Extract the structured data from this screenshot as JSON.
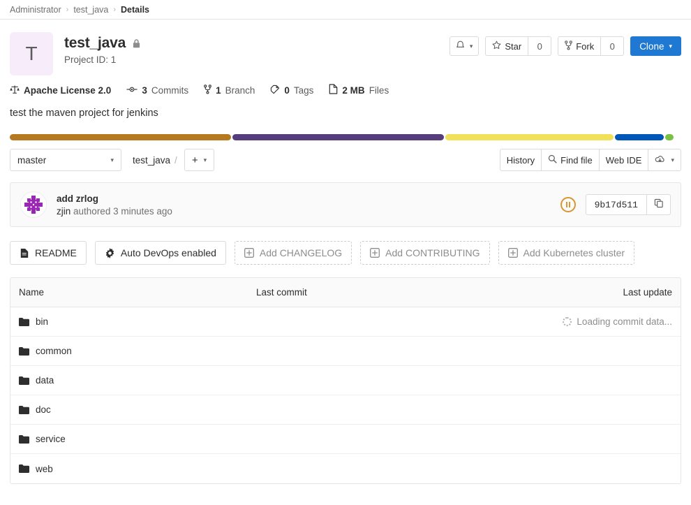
{
  "breadcrumb": {
    "items": [
      "Administrator",
      "test_java"
    ],
    "current": "Details",
    "separator": "›"
  },
  "project": {
    "avatar_letter": "T",
    "avatar_bg": "#f7ecfa",
    "name": "test_java",
    "visibility_icon": "lock-icon",
    "project_id_label": "Project ID: 1",
    "description": "test the maven project for jenkins"
  },
  "header_actions": {
    "notification_icon": "bell-icon",
    "star_label": "Star",
    "star_count": "0",
    "fork_label": "Fork",
    "fork_count": "0",
    "clone_label": "Clone",
    "clone_color": "#1f78d1"
  },
  "stats": [
    {
      "icon": "scale-icon",
      "value": "Apache License 2.0",
      "label": ""
    },
    {
      "icon": "commit-icon",
      "value": "3",
      "label": "Commits"
    },
    {
      "icon": "branch-icon",
      "value": "1",
      "label": "Branch"
    },
    {
      "icon": "tag-icon",
      "value": "0",
      "label": "Tags"
    },
    {
      "icon": "file-icon",
      "value": "2 MB",
      "label": "Files"
    }
  ],
  "language_bar": [
    {
      "color": "#b7791f",
      "percent": 33.0
    },
    {
      "color": "#563d7c",
      "percent": 31.5
    },
    {
      "color": "#f1e05a",
      "percent": 25.0
    },
    {
      "color": "#0057b8",
      "percent": 7.3
    },
    {
      "color": "#7bc043",
      "percent": 1.2
    }
  ],
  "repo_toolbar": {
    "branch": "master",
    "path_root": "test_java",
    "path_separator": "/",
    "add_label": "+",
    "history_label": "History",
    "find_file_label": "Find file",
    "web_ide_label": "Web IDE",
    "download_icon": "download-icon"
  },
  "commit": {
    "title": "add zrlog",
    "author": "zjin",
    "authored_text": "authored 3 minutes ago",
    "sha": "9b17d511",
    "pipeline_status": "pending",
    "pipeline_color": "#d99530",
    "copy_icon": "copy-icon"
  },
  "quick_actions": [
    {
      "label": "README",
      "icon": "doc-icon",
      "dashed": false
    },
    {
      "label": "Auto DevOps enabled",
      "icon": "gear-icon",
      "dashed": false
    },
    {
      "label": "Add CHANGELOG",
      "icon": "plus-box-icon",
      "dashed": true
    },
    {
      "label": "Add CONTRIBUTING",
      "icon": "plus-box-icon",
      "dashed": true
    },
    {
      "label": "Add Kubernetes cluster",
      "icon": "plus-box-icon",
      "dashed": true
    }
  ],
  "file_table": {
    "columns": [
      "Name",
      "Last commit",
      "Last update"
    ],
    "loading_text": "Loading commit data...",
    "rows": [
      {
        "name": "bin",
        "type": "folder",
        "loading": true
      },
      {
        "name": "common",
        "type": "folder",
        "loading": false
      },
      {
        "name": "data",
        "type": "folder",
        "loading": false
      },
      {
        "name": "doc",
        "type": "folder",
        "loading": false
      },
      {
        "name": "service",
        "type": "folder",
        "loading": false
      },
      {
        "name": "web",
        "type": "folder",
        "loading": false
      }
    ]
  }
}
